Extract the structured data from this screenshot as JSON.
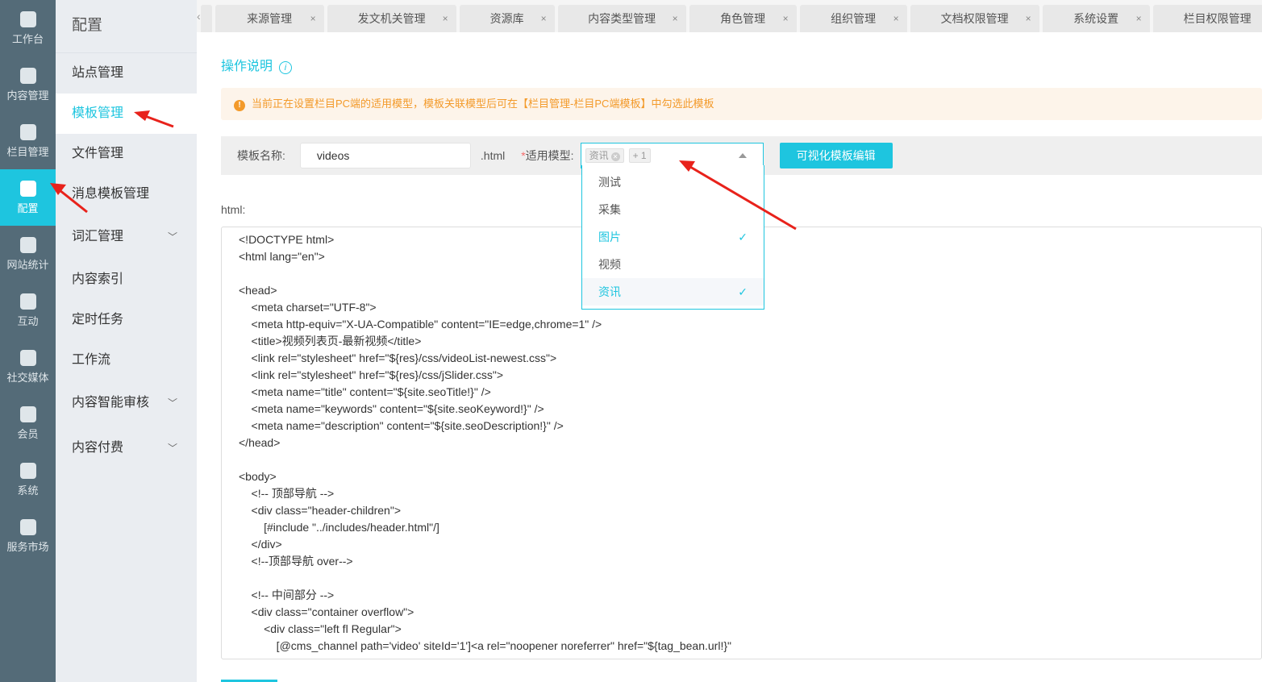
{
  "rail": [
    {
      "label": "工作台",
      "icon": "home-icon"
    },
    {
      "label": "内容管理",
      "icon": "document-icon"
    },
    {
      "label": "栏目管理",
      "icon": "layers-icon"
    },
    {
      "label": "配置",
      "icon": "cube-icon",
      "active": true
    },
    {
      "label": "网站统计",
      "icon": "chart-icon"
    },
    {
      "label": "互动",
      "icon": "chat-icon"
    },
    {
      "label": "社交媒体",
      "icon": "target-icon"
    },
    {
      "label": "会员",
      "icon": "user-icon"
    },
    {
      "label": "系统",
      "icon": "gear-icon"
    },
    {
      "label": "服务市场",
      "icon": "service-icon"
    }
  ],
  "submenu": {
    "title": "配置",
    "items": [
      {
        "label": "站点管理"
      },
      {
        "label": "模板管理",
        "active": true
      },
      {
        "label": "文件管理"
      },
      {
        "label": "消息模板管理"
      },
      {
        "label": "词汇管理",
        "chevron": true
      },
      {
        "label": "内容索引"
      },
      {
        "label": "定时任务"
      },
      {
        "label": "工作流"
      },
      {
        "label": "内容智能审核",
        "chevron": true
      },
      {
        "label": "内容付费",
        "chevron": true
      }
    ]
  },
  "tabs": [
    {
      "label": "来源管理",
      "w": 135
    },
    {
      "label": "发文机关管理",
      "w": 160
    },
    {
      "label": "资源库",
      "w": 118
    },
    {
      "label": "内容类型管理",
      "w": 159
    },
    {
      "label": "角色管理",
      "w": 133
    },
    {
      "label": "组织管理",
      "w": 133
    },
    {
      "label": "文档权限管理",
      "w": 160
    },
    {
      "label": "系统设置",
      "w": 133
    },
    {
      "label": "栏目权限管理",
      "w": 160
    }
  ],
  "help": {
    "label": "操作说明",
    "icon": "i"
  },
  "warning": {
    "icon": "!",
    "text": "当前正在设置栏目PC端的适用模型，模板关联模型后可在【栏目管理-栏目PC端模板】中勾选此模板"
  },
  "form": {
    "name_label": "模板名称:",
    "name_value": "videos",
    "suffix": ".html",
    "required": "*",
    "model_label": "适用模型:",
    "chip": "资讯",
    "more": "+ 1",
    "visual_button": "可视化模板编辑"
  },
  "dropdown": [
    {
      "label": "测试"
    },
    {
      "label": "采集"
    },
    {
      "label": "图片",
      "selected": true
    },
    {
      "label": "视频"
    },
    {
      "label": "资讯",
      "selected": true,
      "hover": true
    }
  ],
  "check": "✓",
  "html_label": "html:",
  "code": [
    "<!DOCTYPE html>",
    "<html lang=\"en\">",
    "",
    "<head>",
    "    <meta charset=\"UTF-8\">",
    "    <meta http-equiv=\"X-UA-Compatible\" content=\"IE=edge,chrome=1\" />",
    "    <title>视频列表页-最新视频</title>",
    "    <link rel=\"stylesheet\" href=\"${res}/css/videoList-newest.css\">",
    "    <link rel=\"stylesheet\" href=\"${res}/css/jSlider.css\">",
    "    <meta name=\"title\" content=\"${site.seoTitle!}\" />",
    "    <meta name=\"keywords\" content=\"${site.seoKeyword!}\" />",
    "    <meta name=\"description\" content=\"${site.seoDescription!}\" />",
    "</head>",
    "",
    "<body>",
    "    <!-- 顶部导航 -->",
    "    <div class=\"header-children\">",
    "        [#include \"../includes/header.html\"/]",
    "    </div>",
    "    <!--顶部导航 over-->",
    "",
    "    <!-- 中间部分 -->",
    "    <div class=\"container overflow\">",
    "        <div class=\"left fl Regular\">",
    "            [@cms_channel path='video' siteId='1']<a rel=\"noopener noreferrer\" href=\"${tag_bean.url!}\""
  ]
}
